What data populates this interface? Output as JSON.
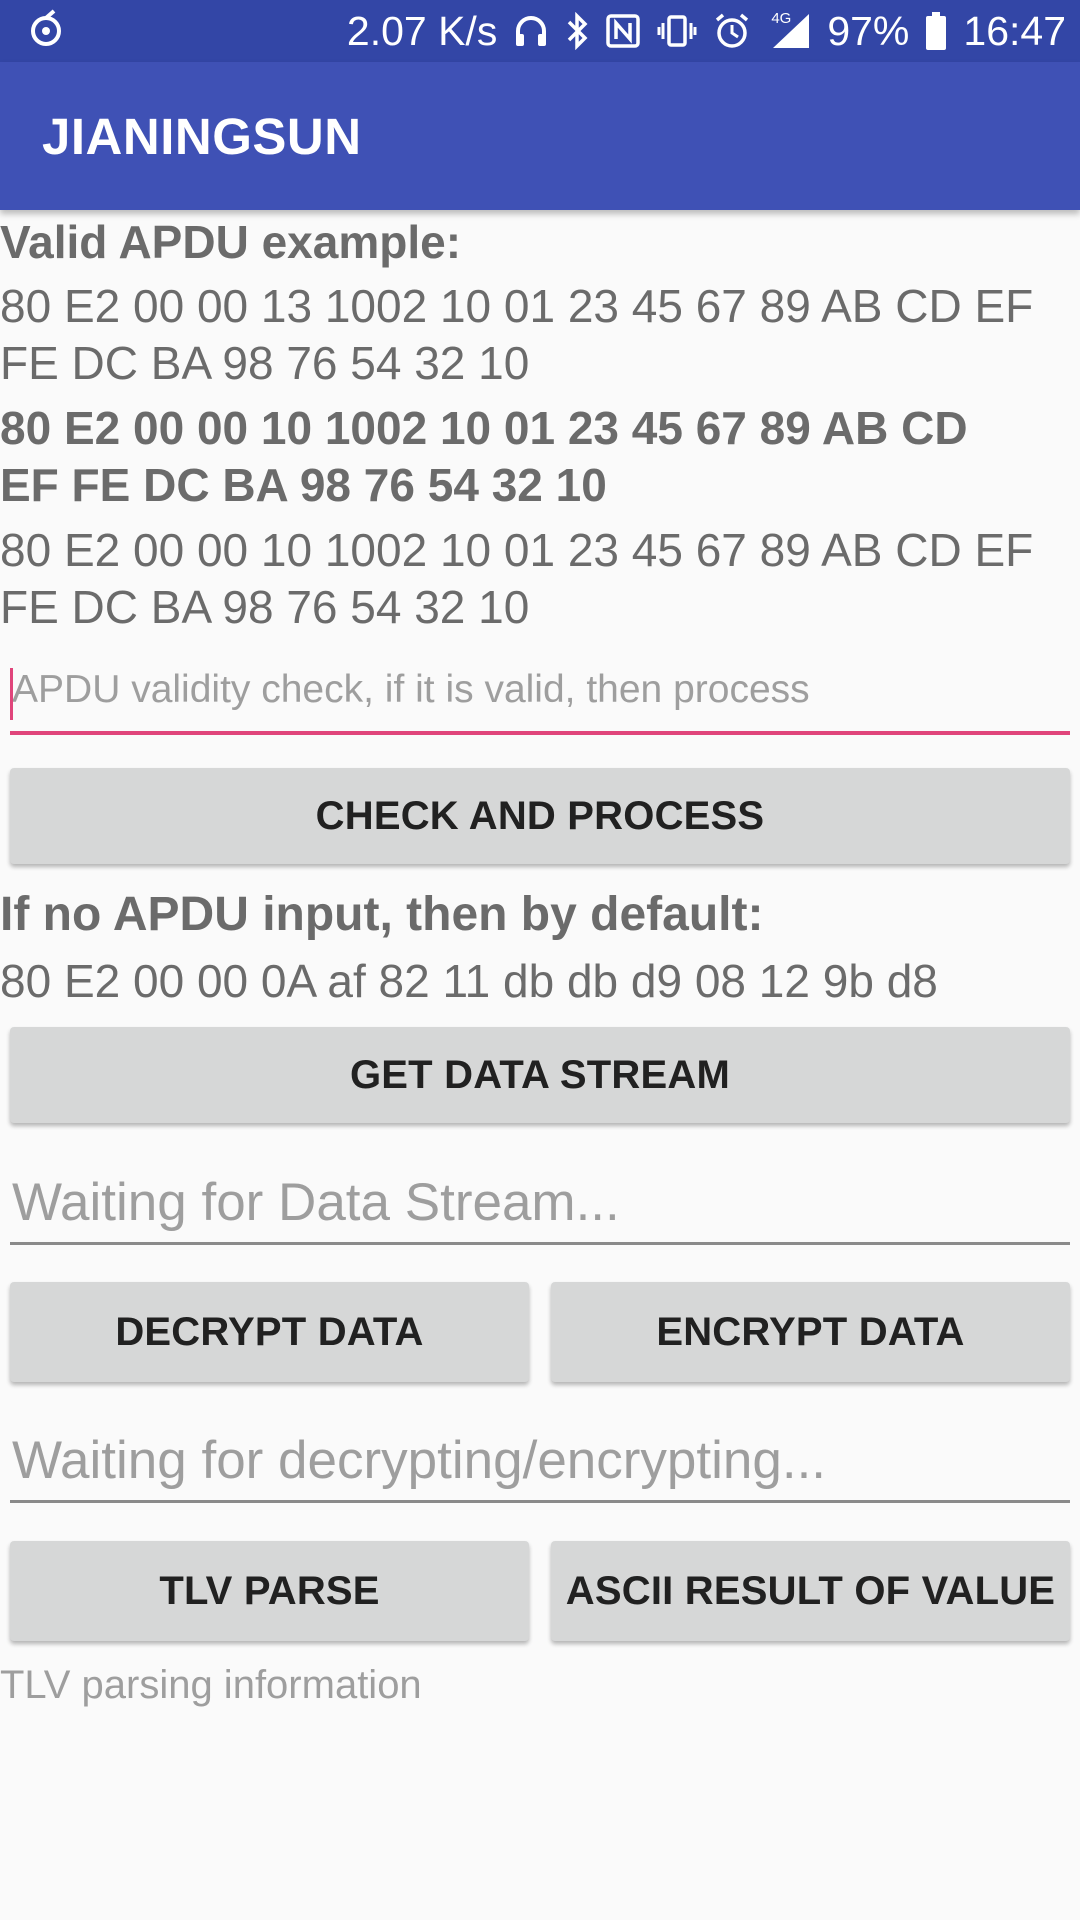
{
  "status_bar": {
    "net_speed": "2.07 K/s",
    "network": "4G",
    "battery": "97%",
    "time": "16:47",
    "icons": [
      "app-notification-icon",
      "headphones-icon",
      "bluetooth-icon",
      "nfc-icon",
      "vibrate-icon",
      "alarm-icon",
      "signal-icon",
      "battery-icon"
    ]
  },
  "app_bar": {
    "title": "JIANINGSUN"
  },
  "examples": {
    "heading": "Valid APDU example:",
    "lines": [
      "80 E2 00 00 13 1002 10 01 23 45 67 89 AB CD EF",
      "FE DC BA 98 76 54 32 10",
      "80 E2 00 00 10 1002 10 01 23 45 67 89 AB CD",
      "EF FE DC BA 98 76 54 32 10",
      "80 E2 00 00 10 1002 10 01 23 45 67 89 AB CD EF",
      "FE DC BA 98 76 54 32 10"
    ]
  },
  "apdu_input": {
    "value": "",
    "placeholder": "APDU validity check, if it is valid, then process"
  },
  "check_button": {
    "label": "CHECK AND PROCESS"
  },
  "default_section": {
    "heading": "If no APDU input, then by default:",
    "value": "80 E2 00 00 0A af 82 11 db db d9 08 12 9b d8"
  },
  "get_stream_button": {
    "label": "GET DATA STREAM"
  },
  "data_stream_field": {
    "placeholder": "Waiting for Data Stream..."
  },
  "decrypt_button": {
    "label": "DECRYPT DATA"
  },
  "encrypt_button": {
    "label": "ENCRYPT DATA"
  },
  "crypt_field": {
    "placeholder": "Waiting for decrypting/encrypting..."
  },
  "tlv_button": {
    "label": "TLV PARSE"
  },
  "ascii_button": {
    "label": "ASCII RESULT OF VALUE"
  },
  "tlv_info": {
    "text": "TLV parsing information"
  },
  "colors": {
    "status_bar": "#3346a6",
    "app_bar": "#3f51b5",
    "accent": "#e0457b",
    "button": "#d6d7d7"
  }
}
